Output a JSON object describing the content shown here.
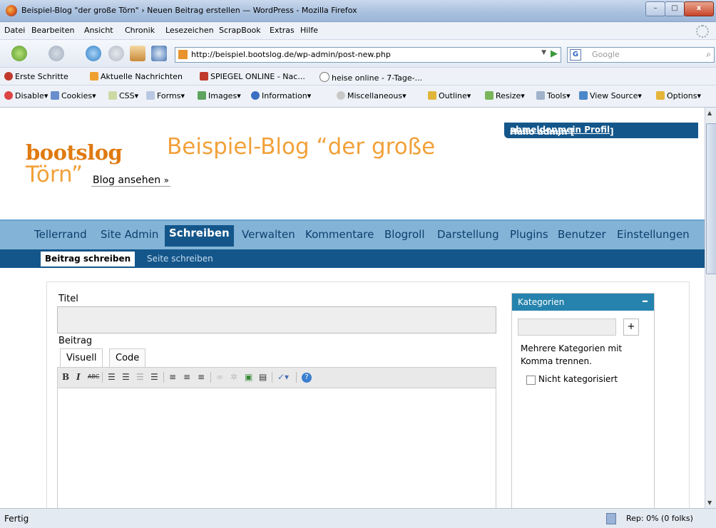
{
  "window": {
    "title": "Beispiel-Blog \"der große Törn\" › Neuen Beitrag erstellen — WordPress - Mozilla Firefox",
    "min": "–",
    "max": "□",
    "close": "x"
  },
  "menu": [
    "Datei",
    "Bearbeiten",
    "Ansicht",
    "Chronik",
    "Lesezeichen",
    "ScrapBook",
    "Extras",
    "Hilfe"
  ],
  "nav": {
    "url": "http://beispiel.bootslog.de/wp-admin/post-new.php",
    "search_placeholder": "Google"
  },
  "bookmarks": [
    "Erste Schritte",
    "Aktuelle Nachrichten",
    "SPIEGEL ONLINE - Nac...",
    "heise online - 7-Tage-..."
  ],
  "devbar": [
    "Disable",
    "Cookies",
    "CSS",
    "Forms",
    "Images",
    "Information",
    "Miscellaneous",
    "Outline",
    "Resize",
    "Tools",
    "View Source",
    "Options"
  ],
  "page": {
    "hello_prefix": "Hallo admin [",
    "logout": "abmelden",
    "profile": "mein Profil",
    "hello_suffix": "]",
    "comma": ", ",
    "logo": "bootslog",
    "blog_title_1": "Beispiel-Blog “der große",
    "blog_title_2": "Törn”",
    "view_blog": "Blog ansehen",
    "view_blog_arrow": "»",
    "admin_menu": [
      "Tellerrand",
      "Site Admin",
      "Schreiben",
      "Verwalten",
      "Kommentare",
      "Blogroll",
      "Darstellung",
      "Plugins",
      "Benutzer",
      "Einstellungen"
    ],
    "submenu": [
      "Beitrag schreiben",
      "Seite schreiben"
    ],
    "label_title": "Titel",
    "label_post": "Beitrag",
    "tab_visual": "Visuell",
    "tab_code": "Code",
    "categories_title": "Kategorien",
    "categories_toggle": "–",
    "categories_add": "+",
    "categories_help": "Mehrere Kategorien mit Komma trennen.",
    "categories_item": "Nicht kategorisiert"
  },
  "status": {
    "text": "Fertig",
    "rep": "Rep: 0% (0 folks)"
  },
  "colors": {
    "wp_blue": "#14568a",
    "menu_blue": "#83b4d8",
    "logo_orange": "#e07a10",
    "title_orange": "#f2a13a",
    "cat_header": "#2583ad"
  }
}
